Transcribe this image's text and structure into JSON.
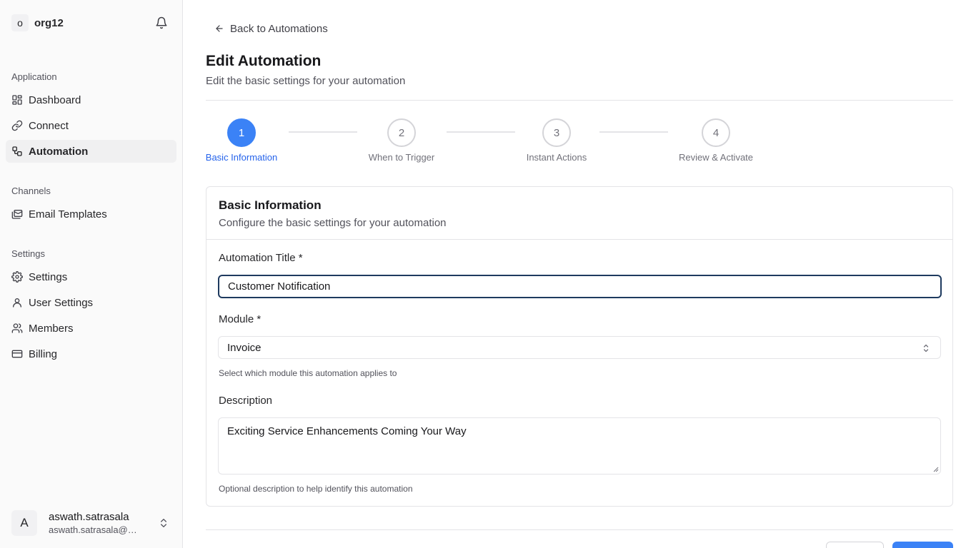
{
  "sidebar": {
    "org": {
      "initial": "o",
      "name": "org12"
    },
    "sections": {
      "application": "Application",
      "channels": "Channels",
      "settings": "Settings"
    },
    "items": {
      "dashboard": "Dashboard",
      "connect": "Connect",
      "automation": "Automation",
      "email_templates": "Email Templates",
      "settings": "Settings",
      "user_settings": "User Settings",
      "members": "Members",
      "billing": "Billing"
    },
    "active_item": "Automation",
    "user": {
      "initial": "A",
      "name": "aswath.satrasala",
      "email": "aswath.satrasala@g..."
    }
  },
  "header": {
    "back_label": "Back to Automations",
    "title": "Edit Automation",
    "subtitle": "Edit the basic settings for your automation"
  },
  "stepper": {
    "current_step": 1,
    "steps": [
      {
        "number": "1",
        "label": "Basic Information"
      },
      {
        "number": "2",
        "label": "When to Trigger"
      },
      {
        "number": "3",
        "label": "Instant Actions"
      },
      {
        "number": "4",
        "label": "Review & Activate"
      }
    ]
  },
  "form": {
    "title": "Basic Information",
    "subtitle": "Configure the basic settings for your automation",
    "automation_title": {
      "label": "Automation Title *",
      "value": "Customer Notification"
    },
    "module": {
      "label": "Module *",
      "value": "Invoice",
      "helper": "Select which module this automation applies to"
    },
    "description": {
      "label": "Description",
      "value": "Exciting Service Enhancements Coming Your Way",
      "helper": "Optional description to help identify this automation"
    }
  },
  "colors": {
    "accent": "#3b82f6",
    "accent_text": "#2563eb",
    "input_focus_border": "#1e3a5f",
    "sidebar_bg": "#fafafa"
  }
}
